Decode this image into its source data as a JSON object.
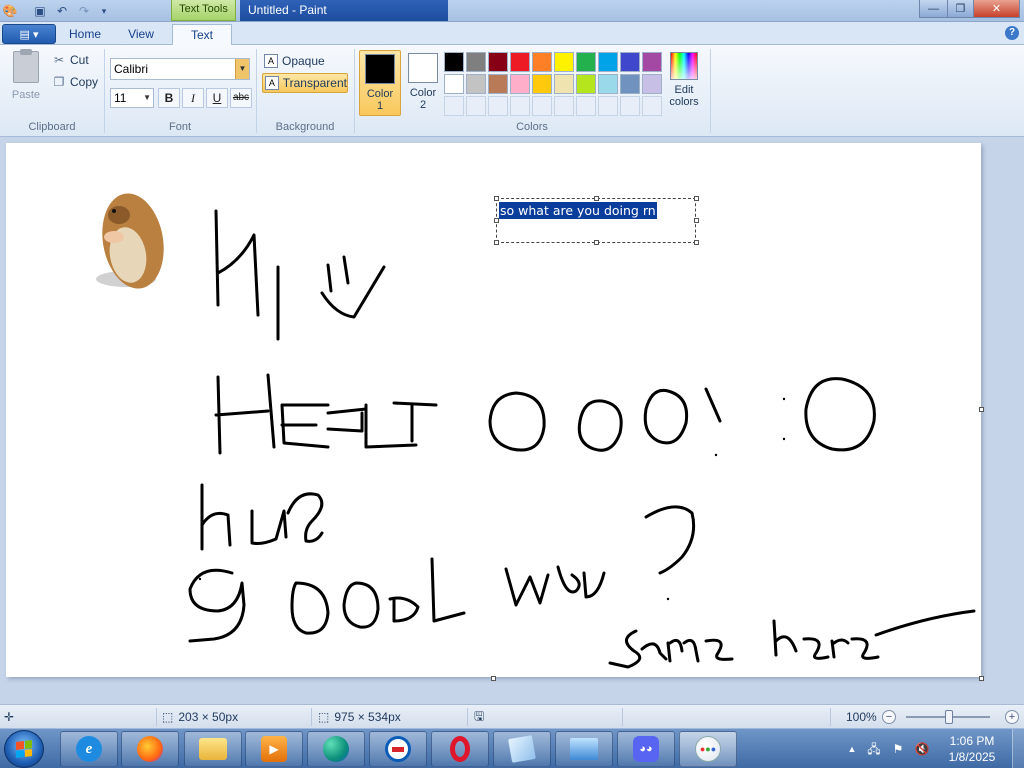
{
  "title_bar": {
    "context_tab": "Text Tools",
    "window_title": "Untitled - Paint",
    "minimize_label": "—",
    "maximize_label": "❐",
    "close_label": "✕"
  },
  "tabs": {
    "app_menu": "▤ ▾",
    "home": "Home",
    "view": "View",
    "text": "Text",
    "help": "?"
  },
  "clipboard": {
    "paste": "Paste",
    "cut": "Cut",
    "copy": "Copy",
    "group": "Clipboard"
  },
  "font": {
    "family": "Calibri",
    "size": "11",
    "bold": "B",
    "italic": "I",
    "underline": "U",
    "strikethrough": "abc",
    "group": "Font"
  },
  "background": {
    "opaque": "Opaque",
    "transparent": "Transparent",
    "group": "Background"
  },
  "colors": {
    "color1_label": "Color",
    "color1_num": "1",
    "color2_label": "Color",
    "color2_num": "2",
    "edit_label": "Edit",
    "edit_label2": "colors",
    "group": "Colors",
    "color1_value": "#000000",
    "color2_value": "#ffffff",
    "palette_row1": [
      "#000000",
      "#7f7f7f",
      "#880015",
      "#ed1c24",
      "#ff7f27",
      "#fff200",
      "#22b14c",
      "#00a2e8",
      "#3f48cc",
      "#a349a4"
    ],
    "palette_row2": [
      "#ffffff",
      "#c3c3c3",
      "#b97a57",
      "#ffaec9",
      "#ffc90e",
      "#efe4b0",
      "#b5e61d",
      "#99d9ea",
      "#7092be",
      "#c8bfe7"
    ]
  },
  "canvas": {
    "textbox_text": "so what are you doing rn"
  },
  "status_bar": {
    "selection_size": "203 × 50px",
    "canvas_size": "975 × 534px",
    "zoom": "100%"
  },
  "taskbar": {
    "apps": [
      "internet-explorer",
      "firefox",
      "file-explorer",
      "media-player",
      "edge-app",
      "outlook",
      "opera",
      "notes-app",
      "remote-desktop",
      "discord",
      "paint"
    ],
    "time": "1:06 PM",
    "date": "1/8/2025"
  }
}
